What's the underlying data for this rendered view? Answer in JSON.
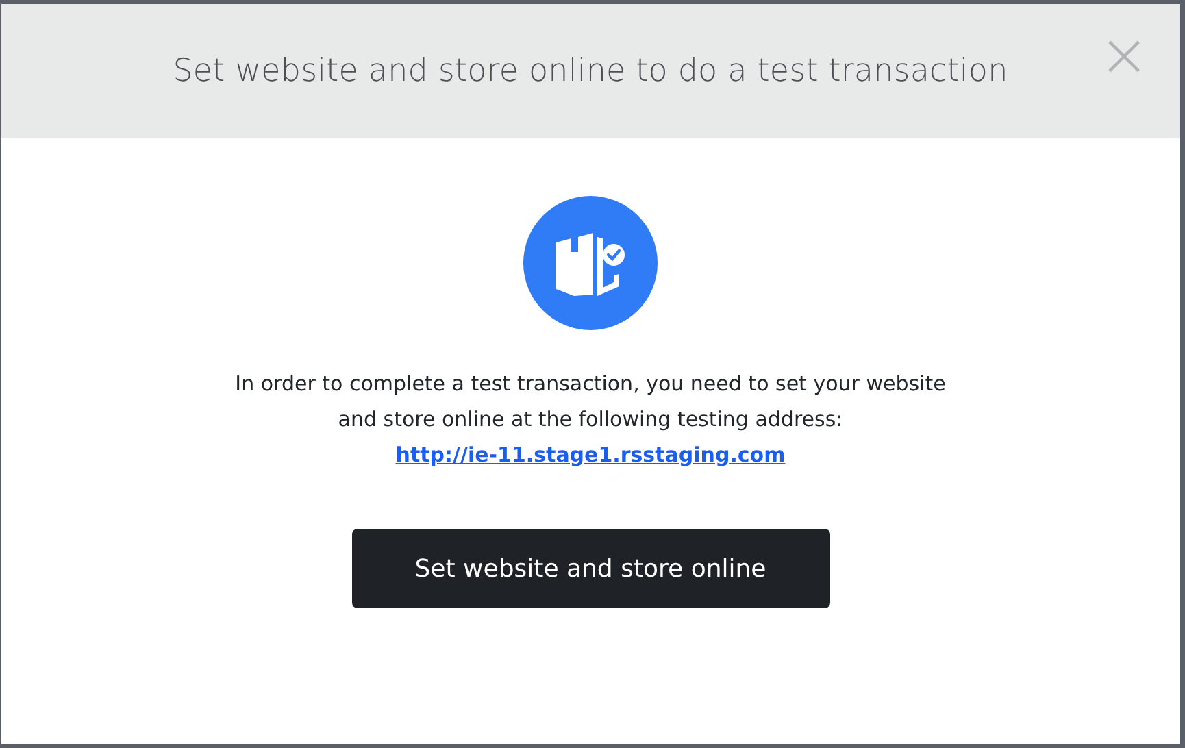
{
  "dialog": {
    "title": "Set website and store online to do a test transaction",
    "close": "×",
    "message": "In order to complete a test transaction, you need to set your website and store online at the following testing address:",
    "link": "http://ie-11.stage1.rsstaging.com",
    "button": "Set website and store online"
  }
}
